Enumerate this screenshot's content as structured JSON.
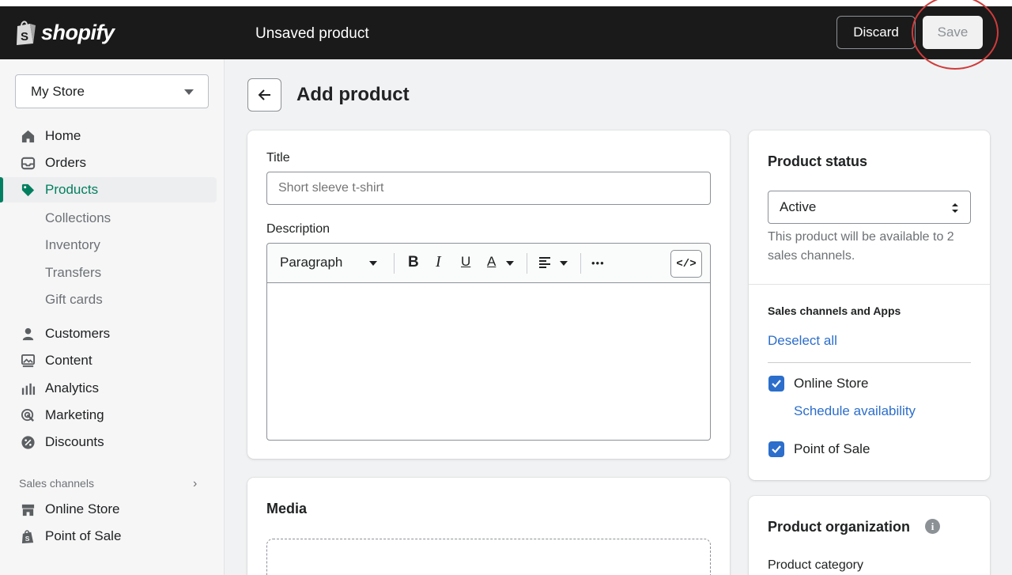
{
  "app": {
    "brand": "shopify",
    "brand_color": "#95bf47"
  },
  "topbar": {
    "title": "Unsaved product",
    "discard_label": "Discard",
    "save_label": "Save"
  },
  "sidebar": {
    "store_name": "My Store",
    "items": [
      {
        "label": "Home",
        "icon": "home-icon"
      },
      {
        "label": "Orders",
        "icon": "inbox-icon"
      },
      {
        "label": "Products",
        "icon": "tag-icon",
        "active": true
      },
      {
        "label": "Collections"
      },
      {
        "label": "Inventory"
      },
      {
        "label": "Transfers"
      },
      {
        "label": "Gift cards"
      },
      {
        "label": "Customers",
        "icon": "person-icon"
      },
      {
        "label": "Content",
        "icon": "image-icon"
      },
      {
        "label": "Analytics",
        "icon": "bar-chart-icon"
      },
      {
        "label": "Marketing",
        "icon": "target-icon"
      },
      {
        "label": "Discounts",
        "icon": "discount-icon"
      }
    ],
    "sales_channels_label": "Sales channels",
    "channels": [
      {
        "label": "Online Store",
        "icon": "storefront-icon"
      },
      {
        "label": "Point of Sale",
        "icon": "shopping-bag-icon"
      }
    ]
  },
  "main": {
    "heading": "Add product",
    "title_label": "Title",
    "title_placeholder": "Short sleeve t-shirt",
    "description_label": "Description",
    "editor": {
      "format_label": "Paragraph",
      "bold": "B",
      "italic": "I",
      "underline": "U",
      "color": "A",
      "more": "•••",
      "code": "</>"
    },
    "media_title": "Media"
  },
  "status_card": {
    "title": "Product status",
    "status_value": "Active",
    "helper": "This product will be available to 2 sales channels.",
    "channels_heading": "Sales channels and Apps",
    "deselect_all": "Deselect all",
    "channel_online": "Online Store",
    "schedule_link": "Schedule availability",
    "channel_pos": "Point of Sale"
  },
  "org_card": {
    "title": "Product organization",
    "category_label": "Product category"
  }
}
